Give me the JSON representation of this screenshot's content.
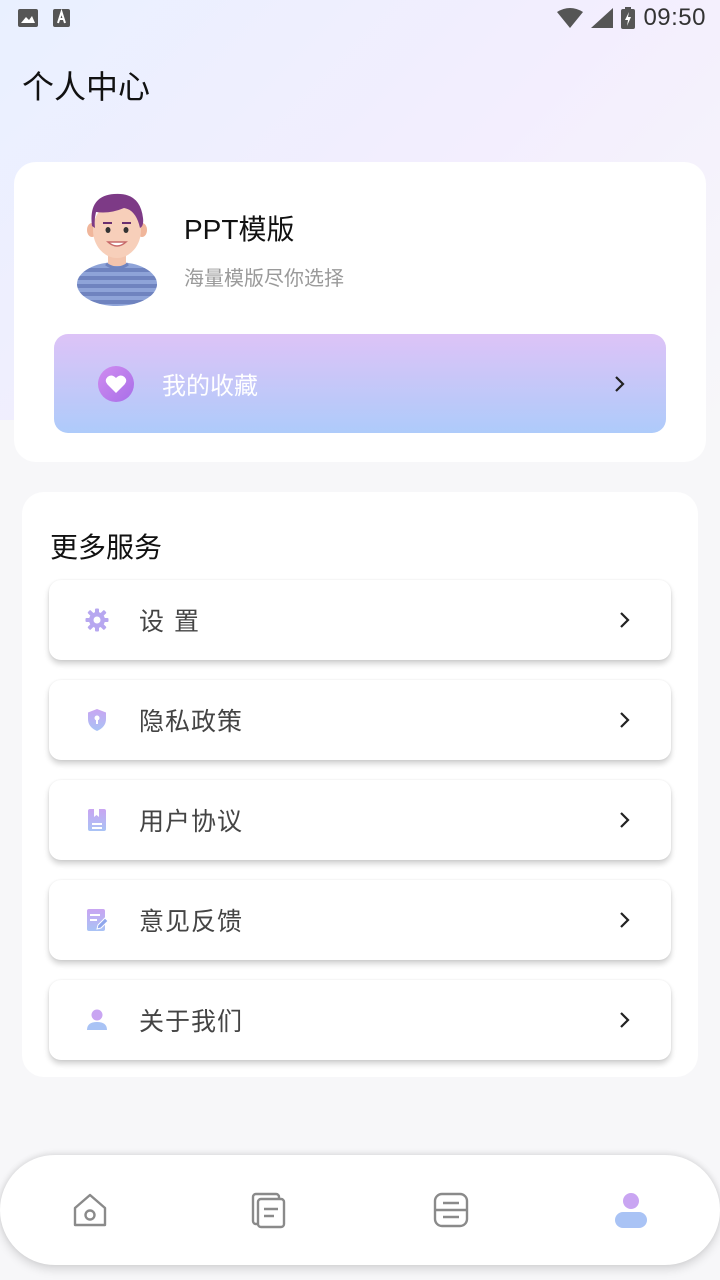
{
  "status_bar": {
    "time": "09:50",
    "icons": [
      "image-icon",
      "a-icon",
      "wifi-icon",
      "signal-icon",
      "battery-charging-icon"
    ]
  },
  "page": {
    "title": "个人中心"
  },
  "profile": {
    "name": "PPT模版",
    "subtitle": "海量模版尽你选择",
    "favorites_label": "我的收藏"
  },
  "services": {
    "title": "更多服务",
    "items": [
      {
        "label": "设 置",
        "icon": "gear-icon"
      },
      {
        "label": "隐私政策",
        "icon": "shield-icon"
      },
      {
        "label": "用户协议",
        "icon": "agreement-icon"
      },
      {
        "label": "意见反馈",
        "icon": "feedback-icon"
      },
      {
        "label": "关于我们",
        "icon": "user-icon"
      }
    ]
  },
  "bottom_nav": {
    "items": [
      {
        "icon": "home-icon",
        "active": false
      },
      {
        "icon": "document-icon",
        "active": false
      },
      {
        "icon": "scan-icon",
        "active": false
      },
      {
        "icon": "profile-icon",
        "active": true
      }
    ]
  },
  "colors": {
    "accent_purple": "#c48cf0",
    "accent_blue": "#aecbfa",
    "inactive_icon": "#8a8a8a"
  }
}
